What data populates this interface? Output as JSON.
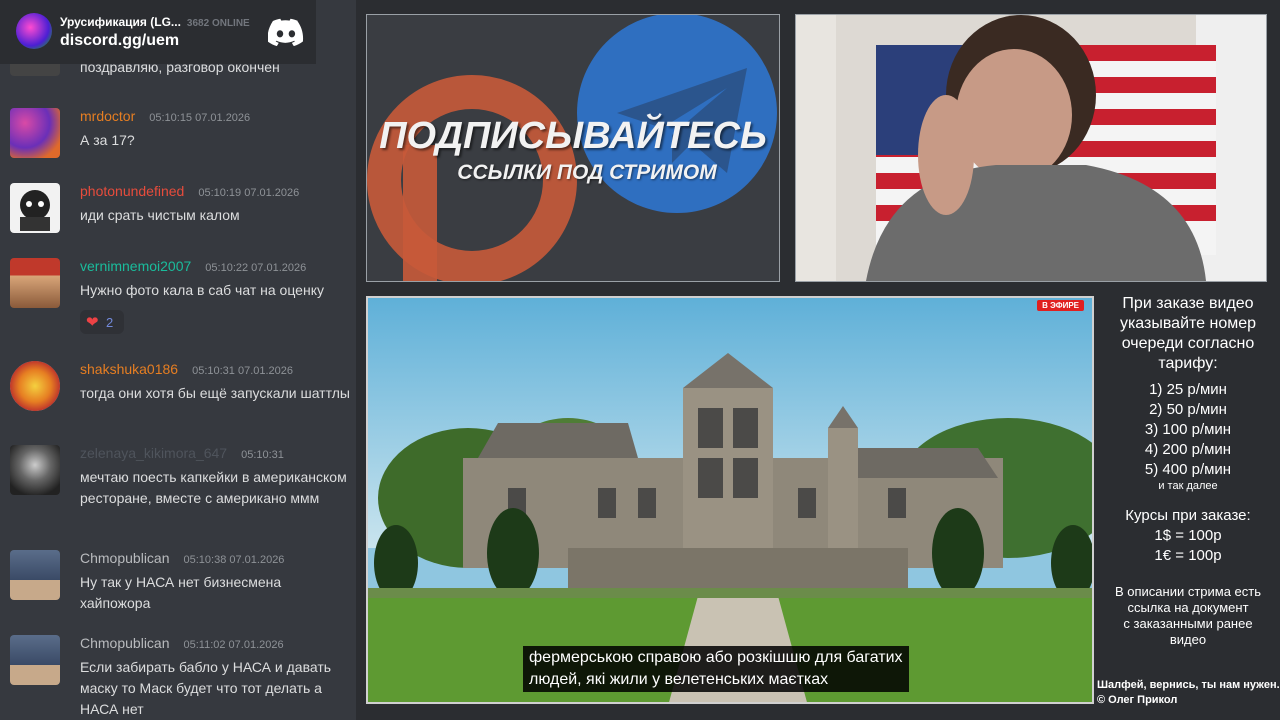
{
  "discord": {
    "server_name": "Урусификация (LG...",
    "online": "3682 ONLINE",
    "invite": "discord.gg/uem"
  },
  "chat": [
    {
      "username": "",
      "timestamp": "",
      "text": "поздравляю, разговор окончен",
      "color": "#dcddde"
    },
    {
      "username": "mrdoctor",
      "timestamp": "05:10:15 07.01.2026",
      "text": "А за 17?",
      "color": "#e67e22"
    },
    {
      "username": "photonundefined",
      "timestamp": "05:10:19 07.01.2026",
      "text": "иди срать чистым калом",
      "color": "#e74c3c"
    },
    {
      "username": "vernimnemoi2007",
      "timestamp": "05:10:22 07.01.2026",
      "text": "Нужно фото кала в саб чат на оценку",
      "color": "#1abc9c",
      "reaction_count": "2"
    },
    {
      "username": "shakshuka0186",
      "timestamp": "05:10:31 07.01.2026",
      "text": "тогда они хотя бы ещё запускали шаттлы",
      "color": "#e67e22"
    },
    {
      "username": "zelenaya_kikimora_647",
      "timestamp": "05:10:31",
      "text": "мечтаю поесть капкейки в американском ресторане, вместе с американо ммм",
      "color": "#4f545c"
    },
    {
      "username": "Chmopublican",
      "timestamp": "05:10:38 07.01.2026",
      "text": "Ну так у НАСА нет бизнесмена хайпожора",
      "color": "#b9bbbe"
    },
    {
      "username": "Chmopublican",
      "timestamp": "05:11:02 07.01.2026",
      "text": "Если забирать бабло у НАСА и давать маску то Маск будет что тот делать а НАСА нет",
      "color": "#b9bbbe"
    }
  ],
  "banner": {
    "title": "ПОДПИСЫВАЙТЕСЬ",
    "subtitle": "ССЫЛКИ ПОД СТРИМОМ"
  },
  "video": {
    "live_badge": "В ЭФИРЕ",
    "subtitle_line1": "фермерською справою або розкішшю для багатих",
    "subtitle_line2": "людей, які жили у велетенських маєтках"
  },
  "info": {
    "header": [
      "При заказе видео",
      "указывайте номер",
      "очереди согласно",
      "тарифу:"
    ],
    "tariffs": [
      "1) 25 р/мин",
      "2) 50 р/мин",
      "3) 100 р/мин",
      "4) 200 р/мин",
      "5) 400 р/мин"
    ],
    "tariffs_more": "и так далее",
    "rates_title": "Курсы при заказе:",
    "rates": [
      "1$ = 100р",
      "1€ = 100р"
    ],
    "description": [
      "В описании стрима есть",
      "ссылка на документ",
      "с заказанными ранее",
      "видео"
    ]
  },
  "credit": {
    "line1": "Шалфей, вернись, ты нам нужен.",
    "line2": "© Олег Прикол"
  }
}
